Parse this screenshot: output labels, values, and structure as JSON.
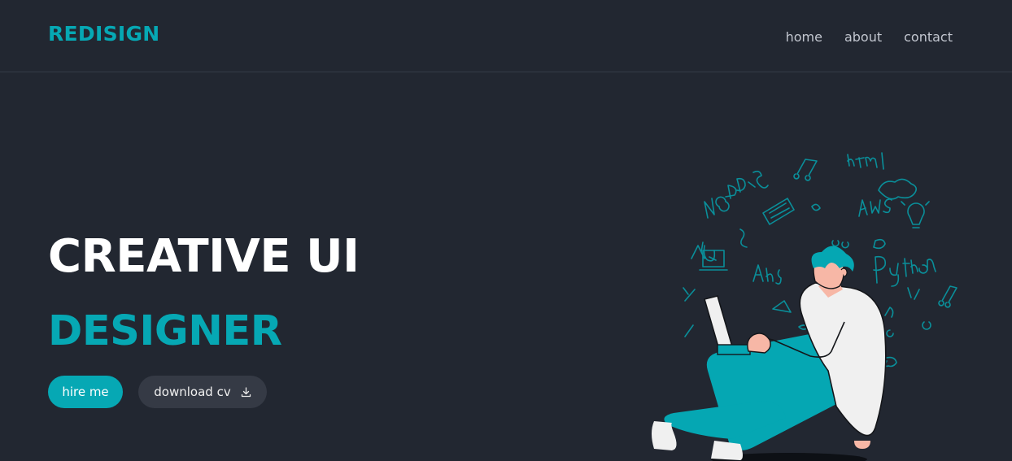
{
  "brand": {
    "logo": "REDISIGN"
  },
  "nav": {
    "items": [
      "home",
      "about",
      "contact"
    ]
  },
  "hero": {
    "title": "CREATIVE UI",
    "subtitle": "DESIGNER",
    "primary_button": "hire me",
    "secondary_button": "download cv",
    "secondary_icon": "download-icon"
  },
  "colors": {
    "background": "#222731",
    "accent": "#06a8b4",
    "button_dark": "#353a45"
  }
}
